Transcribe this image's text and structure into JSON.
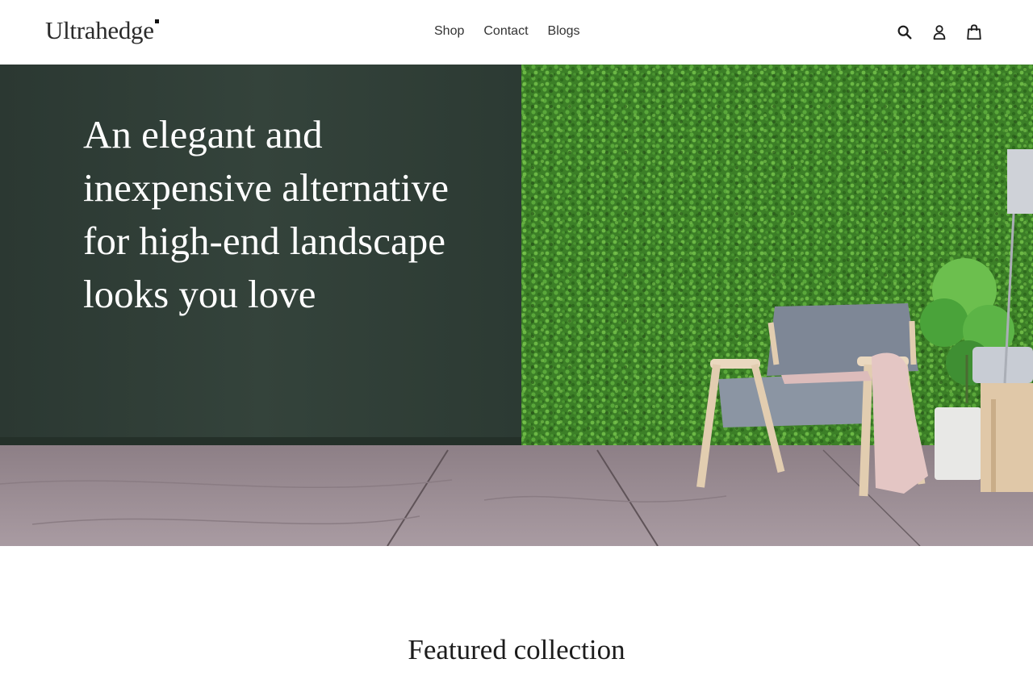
{
  "header": {
    "logo_text": "Ultrahedge",
    "nav": [
      {
        "label": "Shop"
      },
      {
        "label": "Contact"
      },
      {
        "label": "Blogs"
      }
    ],
    "icons": [
      "search-icon",
      "account-icon",
      "cart-icon"
    ]
  },
  "hero": {
    "heading": "An elegant and inexpensive alternative for high-end landscape looks you love",
    "colors": {
      "dark_wall": "#2f3e36",
      "hedge": "#3f8a2a",
      "floor": "#9e8f96"
    }
  },
  "featured": {
    "title": "Featured collection"
  }
}
